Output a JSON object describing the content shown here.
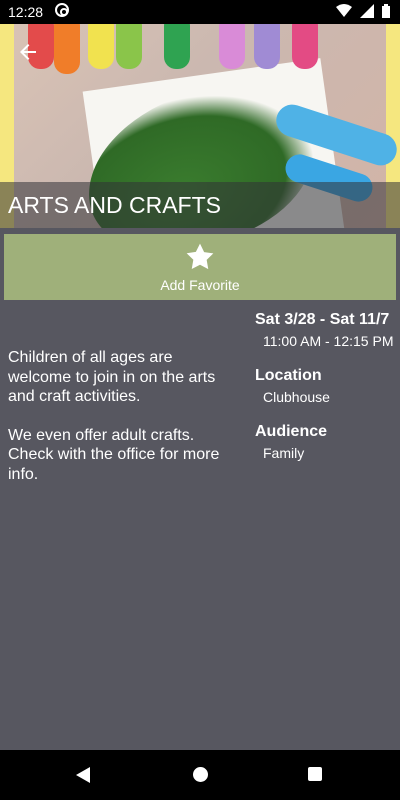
{
  "status": {
    "time": "12:28"
  },
  "event": {
    "title": "ARTS AND CRAFTS",
    "favorite_label": "Add Favorite",
    "date_range": "Sat 3/28 - Sat 11/7",
    "time_range": "11:00 AM - 12:15 PM",
    "description": [
      "Children of all ages are welcome to join in on the arts and craft activities.",
      "We even offer adult crafts. Check with the office for more info."
    ],
    "location_label": "Location",
    "location_value": "Clubhouse",
    "audience_label": "Audience",
    "audience_value": "Family"
  },
  "icons": {
    "back": "arrow-left-icon",
    "star": "star-icon",
    "wifi": "wifi-icon",
    "signal": "signal-icon",
    "battery": "battery-icon"
  }
}
